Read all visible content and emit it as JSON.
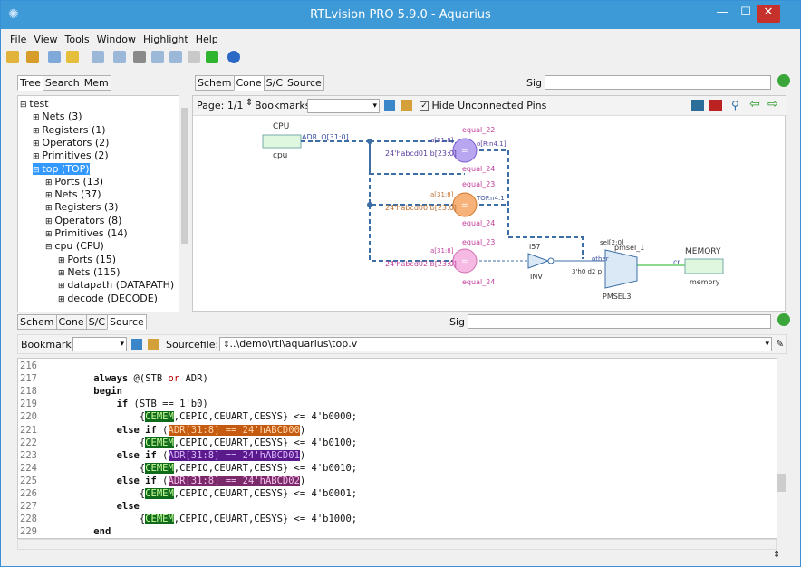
{
  "window": {
    "title": "RTLvision PRO 5.9.0 - Aquarius",
    "min": "—",
    "max": "☐",
    "close": "✕"
  },
  "menu": [
    "File",
    "View",
    "Tools",
    "Window",
    "Highlight",
    "Help"
  ],
  "left_tabs": [
    "Tree",
    "Search",
    "Mem"
  ],
  "tree": [
    {
      "label": "test",
      "indent": 0,
      "exp": "⊟"
    },
    {
      "label": "Nets (3)",
      "indent": 1,
      "exp": "⊞"
    },
    {
      "label": "Registers (1)",
      "indent": 1,
      "exp": "⊞"
    },
    {
      "label": "Operators (2)",
      "indent": 1,
      "exp": "⊞"
    },
    {
      "label": "Primitives (2)",
      "indent": 1,
      "exp": "⊞"
    },
    {
      "label": "top (TOP)",
      "indent": 1,
      "exp": "⊟",
      "sel": true
    },
    {
      "label": "Ports (13)",
      "indent": 2,
      "exp": "⊞"
    },
    {
      "label": "Nets (37)",
      "indent": 2,
      "exp": "⊞"
    },
    {
      "label": "Registers (3)",
      "indent": 2,
      "exp": "⊞"
    },
    {
      "label": "Operators (8)",
      "indent": 2,
      "exp": "⊞"
    },
    {
      "label": "Primitives (14)",
      "indent": 2,
      "exp": "⊞"
    },
    {
      "label": "cpu (CPU)",
      "indent": 2,
      "exp": "⊟"
    },
    {
      "label": "Ports (15)",
      "indent": 3,
      "exp": "⊞"
    },
    {
      "label": "Nets (115)",
      "indent": 3,
      "exp": "⊞"
    },
    {
      "label": "datapath (DATAPATH)",
      "indent": 3,
      "exp": "⊞"
    },
    {
      "label": "decode (DECODE)",
      "indent": 3,
      "exp": "⊞"
    }
  ],
  "top_tabs": [
    "Schem",
    "Cone",
    "S/C",
    "Source"
  ],
  "top_active": "Cone",
  "sig_label": "Sig",
  "schem_toolbar": {
    "page": "Page: 1/1",
    "bookmarks": "Bookmarks:",
    "hide": "Hide Unconnected Pins"
  },
  "schem": {
    "cpu_title": "CPU",
    "cpu_inst": "cpu",
    "adr": "ADR_O[31:0]",
    "eq1_top": "equal_22",
    "eq1_bot": "equal_24",
    "eq1_a": "a[31:8]",
    "eq1_const": "24'habcd01 b[23:0]",
    "eq1_o": "o[R:n4.1]",
    "eq2_top": "equal_23",
    "eq2_bot": "equal_24",
    "eq2_a": "a[31:8]",
    "eq2_const": "24'habcd00 b[23:0]",
    "eq2_o": "TOP.n4.1",
    "eq3_top": "equal_23",
    "eq3_bot": "equal_24",
    "eq3_a": "a[31:8]",
    "eq3_const": "24'habcd02 b[23:0]",
    "inv_top": "i57",
    "inv_bot": "INV",
    "mux_top": "sel[2:0]",
    "mux_name": "pmsel_1",
    "mux_other": "other",
    "mux_d2": "3'h0 d2 p",
    "mux_bot": "PMSEL3",
    "mem_title": "MEMORY",
    "mem_inst": "memory",
    "mem_pin": "cr"
  },
  "bottom_tabs": [
    "Schem",
    "Cone",
    "S/C",
    "Source"
  ],
  "bottom_active": "Source",
  "source_toolbar": {
    "bookmarks": "Bookmarks:",
    "sourcefile_label": "Sourcefile:",
    "sourcefile": "..\\demo\\rtl\\aquarius\\top.v"
  },
  "source": [
    {
      "n": "216",
      "parts": []
    },
    {
      "n": "217",
      "parts": [
        {
          "t": "    "
        },
        {
          "t": "always",
          "c": "kw"
        },
        {
          "t": " @(STB "
        },
        {
          "t": "or",
          "c": "or"
        },
        {
          "t": " ADR)"
        }
      ]
    },
    {
      "n": "218",
      "parts": [
        {
          "t": "    "
        },
        {
          "t": "begin",
          "c": "kw"
        }
      ]
    },
    {
      "n": "219",
      "parts": [
        {
          "t": "        "
        },
        {
          "t": "if",
          "c": "kw"
        },
        {
          "t": " (STB == 1'b0)"
        }
      ]
    },
    {
      "n": "220",
      "parts": [
        {
          "t": "            {"
        },
        {
          "t": "CEMEM",
          "c": "hl-g"
        },
        {
          "t": ",CEPIO,CEUART,CESYS} <= 4'b0000;"
        }
      ]
    },
    {
      "n": "221",
      "parts": [
        {
          "t": "        "
        },
        {
          "t": "else if",
          "c": "kw"
        },
        {
          "t": " ("
        },
        {
          "t": "ADR[31:8] == 24'hABCD00",
          "c": "hl-o"
        },
        {
          "t": ")"
        }
      ]
    },
    {
      "n": "222",
      "parts": [
        {
          "t": "            {"
        },
        {
          "t": "CEMEM",
          "c": "hl-g"
        },
        {
          "t": ",CEPIO,CEUART,CESYS} <= 4'b0100;"
        }
      ]
    },
    {
      "n": "223",
      "parts": [
        {
          "t": "        "
        },
        {
          "t": "else if",
          "c": "kw"
        },
        {
          "t": " ("
        },
        {
          "t": "ADR[31:8] == 24'hABCD01",
          "c": "hl-p"
        },
        {
          "t": ")"
        }
      ]
    },
    {
      "n": "224",
      "parts": [
        {
          "t": "            {"
        },
        {
          "t": "CEMEM",
          "c": "hl-g"
        },
        {
          "t": ",CEPIO,CEUART,CESYS} <= 4'b0010;"
        }
      ]
    },
    {
      "n": "225",
      "parts": [
        {
          "t": "        "
        },
        {
          "t": "else if",
          "c": "kw"
        },
        {
          "t": " ("
        },
        {
          "t": "ADR[31:8] == 24'hABCD02",
          "c": "hl-m"
        },
        {
          "t": ")"
        }
      ]
    },
    {
      "n": "226",
      "parts": [
        {
          "t": "            {"
        },
        {
          "t": "CEMEM",
          "c": "hl-g"
        },
        {
          "t": ",CEPIO,CEUART,CESYS} <= 4'b0001;"
        }
      ]
    },
    {
      "n": "227",
      "parts": [
        {
          "t": "        "
        },
        {
          "t": "else",
          "c": "kw"
        }
      ]
    },
    {
      "n": "228",
      "parts": [
        {
          "t": "            {"
        },
        {
          "t": "CEMEM",
          "c": "hl-g"
        },
        {
          "t": ",CEPIO,CEUART,CESYS} <= 4'b1000;"
        }
      ]
    },
    {
      "n": "229",
      "parts": [
        {
          "t": "    "
        },
        {
          "t": "end",
          "c": "kw"
        }
      ]
    }
  ]
}
